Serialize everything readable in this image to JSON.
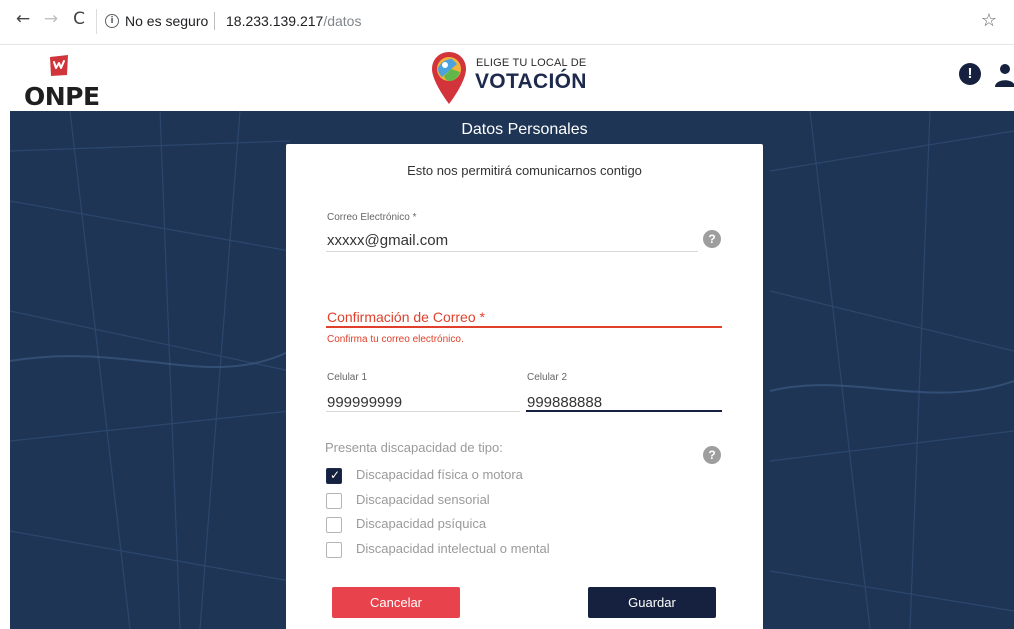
{
  "browser": {
    "back_glyph": "←",
    "forward_glyph": "→",
    "reload_glyph": "C",
    "info_glyph": "i",
    "security_text": "No es seguro",
    "url_host": "18.233.139.217",
    "url_path": "/datos",
    "star_glyph": "☆"
  },
  "header": {
    "org_name": "ONPE",
    "app_line1": "ELIGE TU LOCAL DE",
    "app_line2": "VOTACIÓN",
    "alert_glyph": "!"
  },
  "page": {
    "section_title": "Datos Personales",
    "subtitle": "Esto nos permitirá comunicarnos contigo"
  },
  "form": {
    "email": {
      "label": "Correo Electrónico *",
      "value": "xxxxx@gmail.com"
    },
    "confirm": {
      "label": "Confirmación de Correo *",
      "value": "",
      "error": "Confirma tu correo electrónico."
    },
    "cel1": {
      "label": "Celular 1",
      "value": "999999999"
    },
    "cel2": {
      "label": "Celular 2",
      "value": "999888888"
    },
    "help_glyph": "?",
    "disability_title": "Presenta discapacidad de tipo:",
    "disabilities": [
      {
        "label": "Discapacidad física o motora",
        "checked": true
      },
      {
        "label": "Discapacidad sensorial",
        "checked": false
      },
      {
        "label": "Discapacidad psíquica",
        "checked": false
      },
      {
        "label": "Discapacidad intelectual o mental",
        "checked": false
      }
    ],
    "check_glyph": "✓",
    "cancel_label": "Cancelar",
    "save_label": "Guardar"
  },
  "colors": {
    "navy": "#16213f",
    "error_red": "#e0402b",
    "cancel_red": "#e8434c",
    "map_blue": "#1e3556"
  }
}
